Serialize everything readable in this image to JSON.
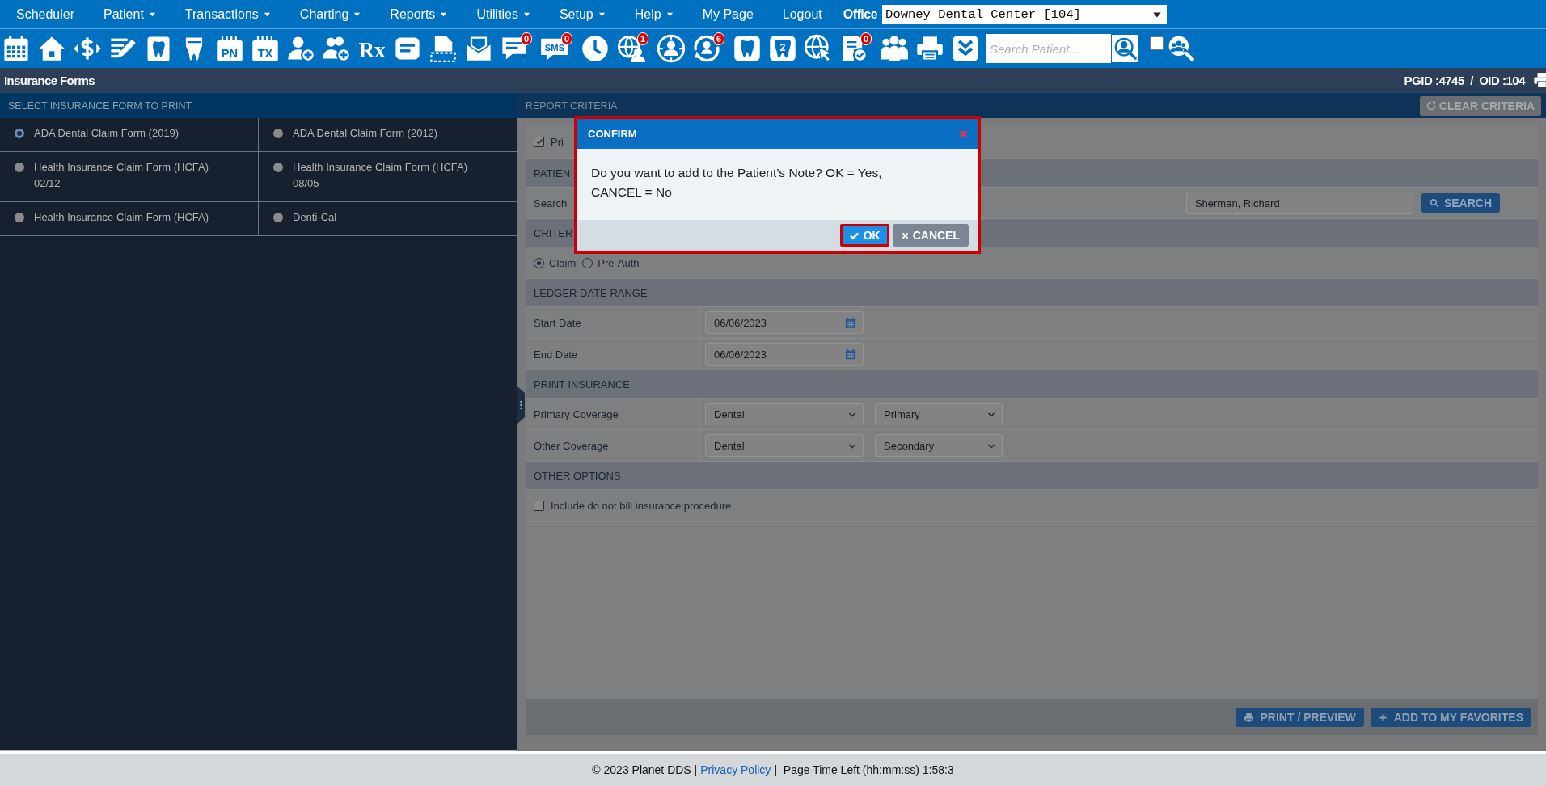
{
  "menu": [
    {
      "label": "Scheduler",
      "dropdown": false
    },
    {
      "label": "Patient",
      "dropdown": true
    },
    {
      "label": "Transactions",
      "dropdown": true
    },
    {
      "label": "Charting",
      "dropdown": true
    },
    {
      "label": "Reports",
      "dropdown": true
    },
    {
      "label": "Utilities",
      "dropdown": true
    },
    {
      "label": "Setup",
      "dropdown": true
    },
    {
      "label": "Help",
      "dropdown": true
    },
    {
      "label": "My Page",
      "dropdown": false
    },
    {
      "label": "Logout",
      "dropdown": false
    }
  ],
  "office": {
    "label": "Office",
    "value": "Downey Dental Center [104]"
  },
  "toolbar": [
    {
      "kind": "calendar"
    },
    {
      "kind": "home"
    },
    {
      "kind": "dollar"
    },
    {
      "kind": "edit"
    },
    {
      "kind": "tooth-frame"
    },
    {
      "kind": "implant"
    },
    {
      "kind": "doc-label",
      "text": "PN"
    },
    {
      "kind": "doc-label",
      "text": "TX"
    },
    {
      "kind": "user-plus"
    },
    {
      "kind": "users-plus"
    },
    {
      "kind": "rx",
      "text": "Rx"
    },
    {
      "kind": "note"
    },
    {
      "kind": "scan"
    },
    {
      "kind": "envelope"
    },
    {
      "kind": "chat",
      "badge": "0"
    },
    {
      "kind": "sms",
      "text": "SMS",
      "badge": "0"
    },
    {
      "kind": "clock"
    },
    {
      "kind": "globe-user",
      "badge": "1"
    },
    {
      "kind": "globe-person"
    },
    {
      "kind": "refresh-user",
      "badge": "6"
    },
    {
      "kind": "tooth"
    },
    {
      "kind": "tooth-label",
      "text": "2"
    },
    {
      "kind": "globe-cursor"
    },
    {
      "kind": "doc-check",
      "badge": "0"
    },
    {
      "kind": "people"
    },
    {
      "kind": "printer"
    },
    {
      "kind": "chevrons"
    }
  ],
  "patient_search": {
    "placeholder": "Search Patient..."
  },
  "toolbar_checkbox": {
    "checked": false
  },
  "page_title": "Insurance Forms",
  "page_ids": "PGID :4745  /  OID :104",
  "forms_panel": {
    "heading": "SELECT INSURANCE FORM TO PRINT",
    "forms": [
      {
        "label": "ADA Dental Claim Form (2019)",
        "selected": true
      },
      {
        "label": "ADA Dental Claim Form (2012)",
        "selected": false
      },
      {
        "label": "Health Insurance Claim Form (HCFA) 02/12",
        "selected": false
      },
      {
        "label": "Health Insurance Claim Form (HCFA) 08/05",
        "selected": false
      },
      {
        "label": "Health Insurance Claim Form (HCFA)",
        "selected": false
      },
      {
        "label": "Denti-Cal",
        "selected": false
      }
    ]
  },
  "report_criteria": {
    "heading": "REPORT CRITERIA",
    "clear_button": "CLEAR CRITERIA",
    "print_option": {
      "label": "Pri",
      "checked": true
    },
    "patient_section": {
      "heading": "PATIEN",
      "search_label": "Search",
      "patient_value": "Sherman, Richard",
      "search_button": "SEARCH"
    },
    "criteria_section": {
      "heading": "CRITER",
      "options": [
        {
          "label": "Claim",
          "selected": true
        },
        {
          "label": "Pre-Auth",
          "selected": false
        }
      ]
    },
    "ledger_date_range": {
      "heading": "LEDGER DATE RANGE",
      "fields": [
        {
          "label": "Start Date",
          "value": "06/06/2023"
        },
        {
          "label": "End Date",
          "value": "06/06/2023"
        }
      ]
    },
    "print_insurance": {
      "heading": "PRINT INSURANCE",
      "rows": [
        {
          "label": "Primary Coverage",
          "type": "Dental",
          "order": "Primary"
        },
        {
          "label": "Other Coverage",
          "type": "Dental",
          "order": "Secondary"
        }
      ]
    },
    "other_options": {
      "heading": "OTHER OPTIONS",
      "options": [
        {
          "label": "Include do not bill insurance procedure",
          "checked": false
        }
      ]
    },
    "actions": [
      {
        "kind": "print",
        "label": "PRINT / PREVIEW"
      },
      {
        "kind": "add",
        "label": "ADD TO MY FAVORITES"
      }
    ]
  },
  "dialog": {
    "title": "CONFIRM",
    "message": "Do you want to add to the Patient’s Note? OK = Yes, CANCEL = No",
    "highlighted": true,
    "buttons": [
      {
        "kind": "ok",
        "label": "OK",
        "highlighted": true
      },
      {
        "kind": "cancel",
        "label": "CANCEL",
        "highlighted": false
      }
    ]
  },
  "footer": {
    "copyright": "© 2023 Planet DDS |",
    "link": "Privacy Policy",
    "time_left": "|  Page Time Left (hh:mm:ss) 1:58:3"
  }
}
